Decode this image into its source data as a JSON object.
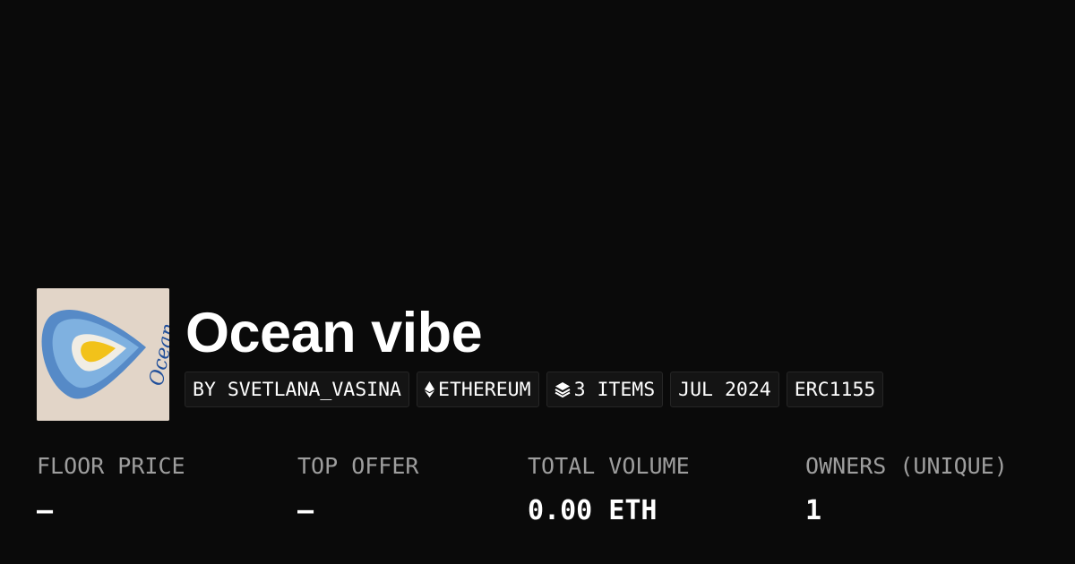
{
  "collection": {
    "name": "Ocean vibe",
    "thumbnail_icon": "heart-watercolor-artwork",
    "thumbnail_text": "Ocean"
  },
  "tags": {
    "creator": "BY SVETLANA_VASINA",
    "chain": "ETHEREUM",
    "chain_icon": "ethereum-icon",
    "items": "3 ITEMS",
    "items_icon": "layers-icon",
    "date": "JUL 2024",
    "standard": "ERC1155"
  },
  "stats": {
    "floor_price": {
      "label": "FLOOR PRICE",
      "value": "–"
    },
    "top_offer": {
      "label": "TOP OFFER",
      "value": "–"
    },
    "total_volume": {
      "label": "TOTAL VOLUME",
      "value": "0.00 ETH"
    },
    "owners": {
      "label": "OWNERS (UNIQUE)",
      "value": "1"
    }
  },
  "colors": {
    "background": "#0a0a0a",
    "text": "#ffffff",
    "muted": "#9e9e9e",
    "pill_bg": "#141414",
    "pill_border": "#262626"
  }
}
